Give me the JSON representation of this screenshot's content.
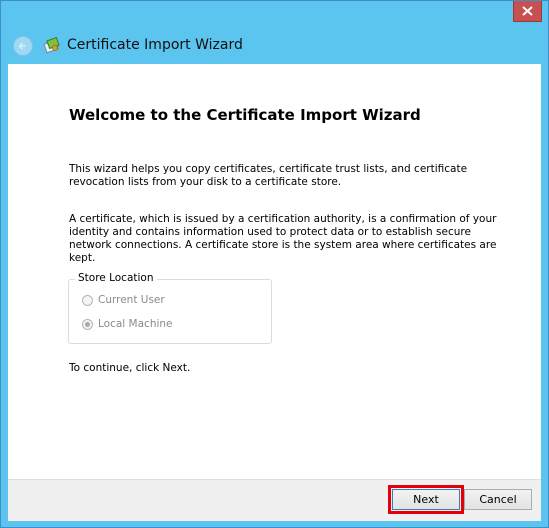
{
  "window": {
    "title": "Certificate Import Wizard",
    "close_icon": "close-icon",
    "back_icon": "back-arrow-icon",
    "app_icon": "certificate-icon",
    "close_color": "#c75050",
    "titlebar_color": "#5bc4ef"
  },
  "main": {
    "heading": "Welcome to the Certificate Import Wizard",
    "paragraph1": "This wizard helps you copy certificates, certificate trust lists, and certificate revocation lists from your disk to a certificate store.",
    "paragraph2": "A certificate, which is issued by a certification authority, is a confirmation of your identity and contains information used to protect data or to establish secure network connections. A certificate store is the system area where certificates are kept.",
    "store_location": {
      "legend": "Store Location",
      "options": [
        {
          "label": "Current User",
          "selected": false,
          "enabled": false
        },
        {
          "label": "Local Machine",
          "selected": true,
          "enabled": false
        }
      ]
    },
    "continue_text": "To continue, click Next."
  },
  "footer": {
    "next_label": "Next",
    "cancel_label": "Cancel",
    "highlight_color": "#e3000b"
  }
}
